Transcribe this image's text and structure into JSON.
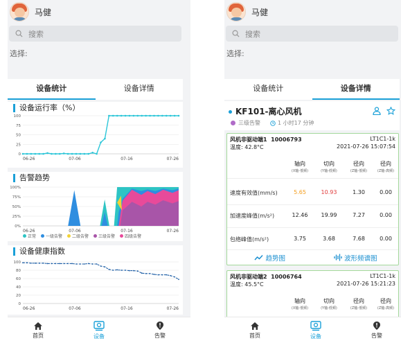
{
  "user": {
    "name": "马健"
  },
  "search": {
    "placeholder": "搜索"
  },
  "select_label": "选择:",
  "tabs": {
    "stats": "设备统计",
    "detail": "设备详情"
  },
  "charts": {
    "uptime": {
      "title": "设备运行率（%）"
    },
    "alarm": {
      "title": "告警趋势"
    },
    "health": {
      "title": "设备健康指数"
    }
  },
  "legend": [
    {
      "label": "正常",
      "color": "#2ec4c4"
    },
    {
      "label": "一级告警",
      "color": "#2f8ee0"
    },
    {
      "label": "二级告警",
      "color": "#f2d236"
    },
    {
      "label": "三级告警",
      "color": "#a855a8"
    },
    {
      "label": "四级告警",
      "color": "#e84a9a"
    }
  ],
  "chart_data": [
    {
      "type": "line",
      "title": "设备运行率（%）",
      "x_ticks": [
        "06-26",
        "07-06",
        "07-16",
        "07-26"
      ],
      "yticks": [
        0,
        25,
        50,
        75,
        100
      ],
      "ylim": [
        0,
        100
      ],
      "series": [
        {
          "values": [
            0,
            0,
            0,
            0,
            0,
            0,
            2,
            0,
            0,
            0,
            1,
            0,
            0,
            0,
            0,
            0,
            0,
            3,
            0,
            30,
            40,
            100,
            100,
            100,
            100,
            100,
            100,
            100,
            100,
            100,
            100,
            100,
            100,
            100,
            100,
            100,
            100,
            100,
            100
          ]
        }
      ]
    },
    {
      "type": "area",
      "title": "告警趋势",
      "x_ticks": [
        "06-26",
        "07-06",
        "07-16",
        "07-26"
      ],
      "yticks": [
        "100%",
        "75%",
        "50%",
        "25%",
        "0%"
      ],
      "ylim": [
        0,
        100
      ],
      "categories_note": "stacked percent",
      "series": [
        {
          "name": "正常",
          "color": "#2ec4c4"
        },
        {
          "name": "一级告警",
          "color": "#2f8ee0"
        },
        {
          "name": "二级告警",
          "color": "#f2d236"
        },
        {
          "name": "三级告警",
          "color": "#a855a8"
        },
        {
          "name": "四级告警",
          "color": "#e84a9a"
        }
      ]
    },
    {
      "type": "line",
      "title": "设备健康指数",
      "x_ticks": [
        "06-26",
        "07-06",
        "07-16",
        "07-26"
      ],
      "yticks": [
        0,
        20,
        40,
        60,
        80,
        100
      ],
      "ylim": [
        0,
        100
      ],
      "series": [
        {
          "values": [
            98,
            98,
            97,
            97,
            97,
            97,
            96,
            96,
            96,
            96,
            96,
            96,
            96,
            95,
            95,
            95,
            96,
            95,
            95,
            90,
            88,
            82,
            80,
            81,
            80,
            80,
            79,
            79,
            78,
            73,
            72,
            72,
            70,
            69,
            69,
            69,
            67,
            64,
            58
          ]
        }
      ]
    }
  ],
  "device": {
    "name": "KF101-离心风机",
    "level": "三级告警",
    "duration": "1 小时17 分钟"
  },
  "measure_cols": [
    {
      "h": "轴向",
      "sub": "(X轴-低频)"
    },
    {
      "h": "切向",
      "sub": "(Y轴-低频)"
    },
    {
      "h": "径向",
      "sub": "(Z轴-低频)"
    },
    {
      "h": "径向",
      "sub": "(Z轴-高频)"
    }
  ],
  "measure_rows": [
    "速度有效值(mm/s)",
    "加速度峰值(m/s²)",
    "包络峰值(m/s²)"
  ],
  "points": [
    {
      "name": "风机非驱动端1",
      "id": "10006793",
      "code": "LT1C1-1k",
      "temp": "温度:  42.8°C",
      "time": "2021-07-26 15:07:54",
      "values": [
        [
          "5.65",
          "10.93",
          "1.30",
          "0.00"
        ],
        [
          "12.46",
          "19.99",
          "7.27",
          "0.00"
        ],
        [
          "3.75",
          "3.68",
          "7.68",
          "0.00"
        ]
      ]
    },
    {
      "name": "风机非驱动端2",
      "id": "10006764",
      "code": "LT1C1-1k",
      "temp": "温度:  45.5°C",
      "time": "2021-07-26 15:21:23"
    }
  ],
  "actions": {
    "trend": "趋势图",
    "wave": "波形频谱图"
  },
  "nav": {
    "home": "首页",
    "device": "设备",
    "alarm": "告警"
  }
}
